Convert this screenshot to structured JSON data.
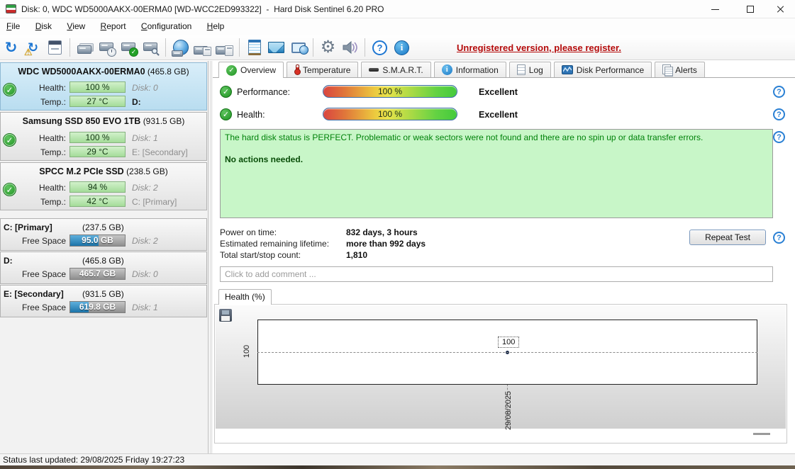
{
  "window": {
    "title": "Disk: 0, WDC WD5000AAKX-00ERMA0 [WD-WCC2ED993322]  -  Hard Disk Sentinel 6.20 PRO",
    "controls": [
      "minimize",
      "maximize",
      "close"
    ]
  },
  "menu": {
    "items": [
      "File",
      "Disk",
      "View",
      "Report",
      "Configuration",
      "Help"
    ]
  },
  "toolbar": {
    "unregistered": "Unregistered version, please register.",
    "icons": [
      "refresh",
      "analyse-disks",
      "report",
      "remove-disk",
      "disk-schedule",
      "disk-test",
      "disk-surface-scan",
      "network-disks",
      "disk-eject",
      "disk-connect",
      "log",
      "send-email",
      "network-monitor",
      "settings-gear",
      "sounds",
      "help",
      "information"
    ]
  },
  "tabs": [
    {
      "label": "Overview"
    },
    {
      "label": "Temperature"
    },
    {
      "label": "S.M.A.R.T."
    },
    {
      "label": "Information"
    },
    {
      "label": "Log"
    },
    {
      "label": "Disk Performance"
    },
    {
      "label": "Alerts"
    }
  ],
  "sidebar": {
    "disks": [
      {
        "name": "WDC WD5000AAKX-00ERMA0",
        "size": "(465.8 GB)",
        "health_label": "Health:",
        "health": "100 %",
        "disk_no": "Disk: 0",
        "temp_label": "Temp.:",
        "temp": "27 °C",
        "drive": "D:",
        "selected": true
      },
      {
        "name": "Samsung SSD 850 EVO 1TB",
        "size": "(931.5 GB)",
        "health_label": "Health:",
        "health": "100 %",
        "disk_no": "Disk: 1",
        "temp_label": "Temp.:",
        "temp": "29 °C",
        "drive": "E: [Secondary]",
        "selected": false
      },
      {
        "name": "SPCC M.2 PCIe SSD",
        "size": "(238.5 GB)",
        "health_label": "Health:",
        "health": "94 %",
        "disk_no": "Disk: 2",
        "temp_label": "Temp.:",
        "temp": "42 °C",
        "drive": "C: [Primary]",
        "selected": false
      }
    ],
    "partitions": [
      {
        "name": "C: [Primary]",
        "size": "(237.5 GB)",
        "free_label": "Free Space",
        "free": "95.0 GB",
        "disk_no": "Disk: 2",
        "bar_fill_pct": 52
      },
      {
        "name": "D:",
        "size": "(465.8 GB)",
        "free_label": "Free Space",
        "free": "465.7 GB",
        "disk_no": "Disk: 0",
        "bar_fill_pct": 0
      },
      {
        "name": "E: [Secondary]",
        "size": "(931.5 GB)",
        "free_label": "Free Space",
        "free": "619.8 GB",
        "disk_no": "Disk: 1",
        "bar_fill_pct": 34
      }
    ]
  },
  "overview": {
    "performance": {
      "label": "Performance:",
      "value": "100 %",
      "rating": "Excellent"
    },
    "health": {
      "label": "Health:",
      "value": "100 %",
      "rating": "Excellent"
    },
    "status_message": {
      "line1": "The hard disk status is PERFECT. Problematic or weak sectors were not found and there are no spin up or data transfer errors.",
      "line2": "No actions needed."
    },
    "stats": [
      {
        "label": "Power on time:",
        "value": "832 days, 3 hours"
      },
      {
        "label": "Estimated remaining lifetime:",
        "value": "more than 992 days"
      },
      {
        "label": "Total start/stop count:",
        "value": "1,810"
      }
    ],
    "repeat_test_label": "Repeat Test",
    "comment_placeholder": "Click to add comment ..."
  },
  "chart": {
    "tab_label": "Health (%)",
    "ytick": "100",
    "xtick": "29/08/2025",
    "point_label": "100"
  },
  "chart_data": {
    "type": "line",
    "title": "Health (%)",
    "x": [
      "29/08/2025"
    ],
    "series": [
      {
        "name": "Health",
        "values": [
          100
        ]
      }
    ],
    "ytick_labels": [
      "100"
    ],
    "grid": "dashed-crosshair",
    "legend": "none"
  },
  "statusbar": {
    "text": "Status last updated: 29/08/2025 Friday 19:27:23"
  },
  "colors": {
    "accent_blue": "#1d76d2",
    "health_bar_green": "#a4dc99",
    "gauge_gradient": [
      "#da4540",
      "#ecc83e",
      "#44ca3c"
    ],
    "status_box_green": "#c8f6c8",
    "free_space_blue": "#1b73a8",
    "unregistered_red": "#b40a0a",
    "selected_disk_blue": "#c4e4f5"
  }
}
